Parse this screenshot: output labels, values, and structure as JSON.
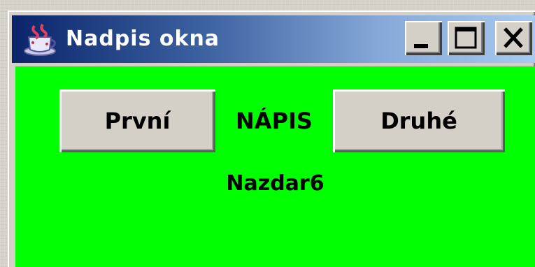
{
  "window": {
    "title": "Nadpis okna",
    "icon": "java-cup-icon",
    "controls": {
      "minimize": "minimize-icon",
      "maximize": "maximize-icon",
      "close": "close-icon"
    }
  },
  "content": {
    "background_color": "#00ff00",
    "button_first_label": "První",
    "center_label": "NÁPIS",
    "button_second_label": "Druhé",
    "bottom_label": "Nazdar6"
  }
}
